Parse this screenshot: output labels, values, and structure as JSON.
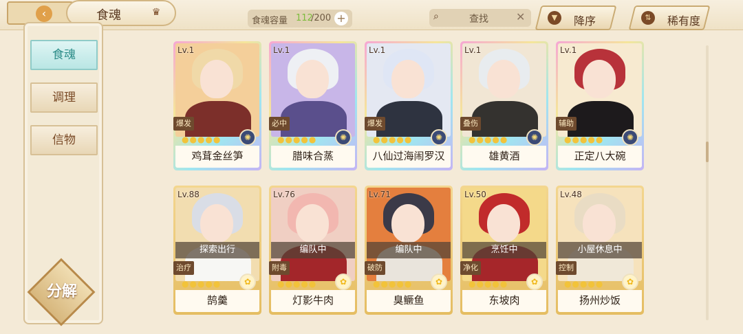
{
  "header": {
    "tab_title": "食魂",
    "capacity_label": "食魂容量",
    "capacity_current": "112",
    "capacity_total": "/200",
    "search_text": "查找",
    "sort_order": "降序",
    "sort_by": "稀有度"
  },
  "sidebar": {
    "items": [
      {
        "label": "食魂",
        "active": true
      },
      {
        "label": "调理",
        "active": false
      },
      {
        "label": "信物",
        "active": false
      }
    ],
    "decompose_label": "分解"
  },
  "cards": [
    {
      "level": "Lv.1",
      "name": "鸡茸金丝笋",
      "badge": "爆发",
      "status": "",
      "style": "rare"
    },
    {
      "level": "Lv.1",
      "name": "腊味合蒸",
      "badge": "必中",
      "status": "",
      "style": "rare"
    },
    {
      "level": "Lv.1",
      "name": "八仙过海闹罗汉",
      "badge": "爆发",
      "status": "",
      "style": "rare"
    },
    {
      "level": "Lv.1",
      "name": "雄黄酒",
      "badge": "叠伤",
      "status": "",
      "style": "rare"
    },
    {
      "level": "Lv.1",
      "name": "正定八大碗",
      "badge": "辅助",
      "status": "",
      "style": "rare"
    },
    {
      "level": "Lv.88",
      "name": "鹄羹",
      "badge": "治疗",
      "status": "探索出行",
      "style": "gold"
    },
    {
      "level": "Lv.76",
      "name": "灯影牛肉",
      "badge": "附毒",
      "status": "编队中",
      "style": "gold"
    },
    {
      "level": "Lv.71",
      "name": "臭鳜鱼",
      "badge": "破防",
      "status": "编队中",
      "style": "gold"
    },
    {
      "level": "Lv.50",
      "name": "东坡肉",
      "badge": "净化",
      "status": "烹饪中",
      "style": "gold"
    },
    {
      "level": "Lv.48",
      "name": "扬州炒饭",
      "badge": "控制",
      "status": "小屋休息中",
      "style": "gold"
    }
  ]
}
